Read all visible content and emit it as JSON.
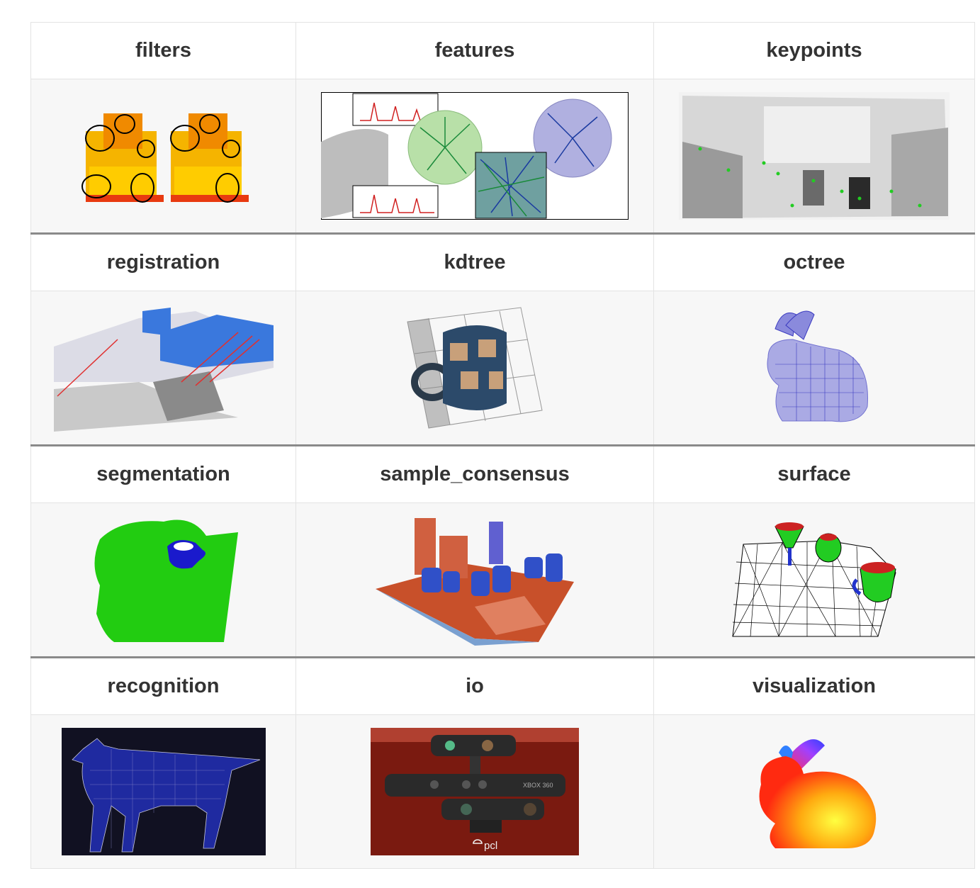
{
  "grid": {
    "rows": [
      {
        "labels": [
          "filters",
          "features",
          "keypoints"
        ]
      },
      {
        "labels": [
          "registration",
          "kdtree",
          "octree"
        ]
      },
      {
        "labels": [
          "segmentation",
          "sample_consensus",
          "surface"
        ]
      },
      {
        "labels": [
          "recognition",
          "io",
          "visualization"
        ]
      }
    ],
    "io_caption": "pcl",
    "sensor_label": "XBOX 360"
  },
  "colors": {
    "header_bg": "#ffffff",
    "image_row_bg": "#f7f7f7",
    "border": "#e3e3e3",
    "row_separator": "#8a8a8a",
    "label_text": "#333333"
  }
}
